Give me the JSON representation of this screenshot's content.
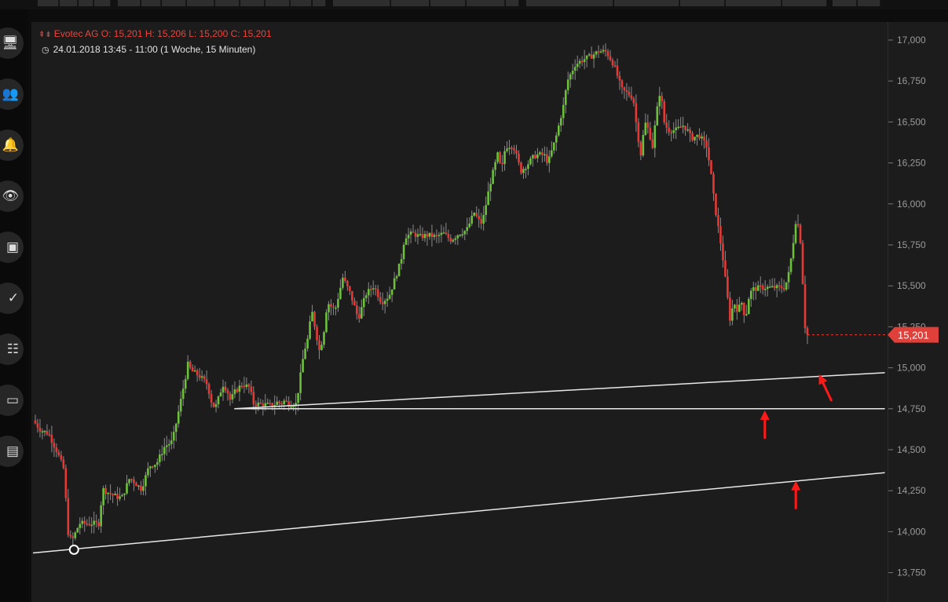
{
  "header": {
    "quote_line": "Evotec AG  O: 15,201  H: 15,206  L: 15,200  C: 15,201",
    "range_line": "24.01.2018 13:45 - 11:00   (1 Woche, 15 Minuten)"
  },
  "sidebar": [
    {
      "name": "monitor-icon",
      "glyph": "🖥"
    },
    {
      "name": "users-icon",
      "glyph": "👥"
    },
    {
      "name": "bell-icon",
      "glyph": "🔔"
    },
    {
      "name": "eye-icon",
      "glyph": "👁"
    },
    {
      "name": "card-icon",
      "glyph": "▣"
    },
    {
      "name": "check-icon",
      "glyph": "✓"
    },
    {
      "name": "list-icon",
      "glyph": "☷"
    },
    {
      "name": "window-icon",
      "glyph": "▭"
    },
    {
      "name": "id-card-icon",
      "glyph": "▤"
    }
  ],
  "colors": {
    "up": "#6cc13a",
    "down": "#e53935",
    "price_tag": "#e0403a",
    "background": "#1c1c1c",
    "arrow": "#ff1a1a"
  },
  "chart_data": {
    "type": "candlestick",
    "title": "Evotec AG",
    "ylim": [
      13750,
      17000
    ],
    "y_ticks": [
      "17,000",
      "16,750",
      "16,500",
      "16,250",
      "16,000",
      "15,750",
      "15,500",
      "15,250",
      "15,000",
      "14,750",
      "14,500",
      "14,250",
      "14,000",
      "13,750"
    ],
    "last_price_label": "15,201",
    "price_path": [
      [
        0,
        14680
      ],
      [
        0.01,
        14620
      ],
      [
        0.02,
        14600
      ],
      [
        0.03,
        14500
      ],
      [
        0.04,
        14380
      ],
      [
        0.045,
        14000
      ],
      [
        0.05,
        13940
      ],
      [
        0.06,
        14050
      ],
      [
        0.085,
        14050
      ],
      [
        0.09,
        14260
      ],
      [
        0.1,
        14230
      ],
      [
        0.11,
        14210
      ],
      [
        0.115,
        14210
      ],
      [
        0.125,
        14330
      ],
      [
        0.14,
        14260
      ],
      [
        0.15,
        14400
      ],
      [
        0.16,
        14420
      ],
      [
        0.17,
        14520
      ],
      [
        0.18,
        14550
      ],
      [
        0.19,
        14780
      ],
      [
        0.2,
        15020
      ],
      [
        0.205,
        14980
      ],
      [
        0.215,
        14950
      ],
      [
        0.225,
        14900
      ],
      [
        0.23,
        14800
      ],
      [
        0.235,
        14750
      ],
      [
        0.24,
        14820
      ],
      [
        0.245,
        14900
      ],
      [
        0.25,
        14870
      ],
      [
        0.255,
        14800
      ],
      [
        0.26,
        14850
      ],
      [
        0.27,
        14900
      ],
      [
        0.28,
        14880
      ],
      [
        0.28,
        14870
      ],
      [
        0.285,
        14780
      ],
      [
        0.29,
        14780
      ],
      [
        0.31,
        14770
      ],
      [
        0.315,
        14790
      ],
      [
        0.32,
        14780
      ],
      [
        0.325,
        14800
      ],
      [
        0.33,
        14780
      ],
      [
        0.34,
        14780
      ],
      [
        0.35,
        15100
      ],
      [
        0.355,
        15180
      ],
      [
        0.36,
        15350
      ],
      [
        0.37,
        15100
      ],
      [
        0.375,
        15200
      ],
      [
        0.38,
        15400
      ],
      [
        0.39,
        15350
      ],
      [
        0.4,
        15550
      ],
      [
        0.41,
        15450
      ],
      [
        0.42,
        15300
      ],
      [
        0.43,
        15450
      ],
      [
        0.44,
        15500
      ],
      [
        0.45,
        15400
      ],
      [
        0.46,
        15440
      ],
      [
        0.475,
        15650
      ],
      [
        0.48,
        15800
      ],
      [
        0.49,
        15820
      ],
      [
        0.5,
        15800
      ],
      [
        0.51,
        15810
      ],
      [
        0.52,
        15800
      ],
      [
        0.53,
        15820
      ],
      [
        0.54,
        15780
      ],
      [
        0.55,
        15820
      ],
      [
        0.56,
        15840
      ],
      [
        0.57,
        15950
      ],
      [
        0.575,
        15900
      ],
      [
        0.58,
        15880
      ],
      [
        0.585,
        16000
      ],
      [
        0.59,
        16120
      ],
      [
        0.6,
        16300
      ],
      [
        0.605,
        16200
      ],
      [
        0.61,
        16350
      ],
      [
        0.62,
        16360
      ],
      [
        0.625,
        16280
      ],
      [
        0.63,
        16200
      ],
      [
        0.64,
        16250
      ],
      [
        0.645,
        16280
      ],
      [
        0.65,
        16300
      ],
      [
        0.66,
        16300
      ],
      [
        0.665,
        16250
      ],
      [
        0.675,
        16400
      ],
      [
        0.68,
        16500
      ],
      [
        0.685,
        16600
      ],
      [
        0.69,
        16750
      ],
      [
        0.7,
        16850
      ],
      [
        0.71,
        16880
      ],
      [
        0.72,
        16900
      ],
      [
        0.73,
        16930
      ],
      [
        0.74,
        16930
      ],
      [
        0.75,
        16850
      ],
      [
        0.76,
        16700
      ],
      [
        0.775,
        16650
      ],
      [
        0.78,
        16450
      ],
      [
        0.785,
        16300
      ],
      [
        0.79,
        16500
      ],
      [
        0.795,
        16450
      ],
      [
        0.8,
        16350
      ],
      [
        0.805,
        16550
      ],
      [
        0.81,
        16700
      ],
      [
        0.815,
        16500
      ],
      [
        0.82,
        16450
      ],
      [
        0.83,
        16450
      ],
      [
        0.84,
        16480
      ],
      [
        0.845,
        16450
      ],
      [
        0.85,
        16400
      ],
      [
        0.86,
        16420
      ],
      [
        0.87,
        16350
      ],
      [
        0.875,
        16200
      ],
      [
        0.88,
        16000
      ],
      [
        0.885,
        15850
      ],
      [
        0.89,
        15700
      ],
      [
        0.895,
        15500
      ],
      [
        0.9,
        15300
      ],
      [
        0.905,
        15400
      ],
      [
        0.91,
        15350
      ],
      [
        0.915,
        15400
      ],
      [
        0.92,
        15300
      ],
      [
        0.925,
        15450
      ],
      [
        0.93,
        15480
      ],
      [
        0.94,
        15490
      ],
      [
        0.96,
        15490
      ],
      [
        0.97,
        15490
      ],
      [
        0.975,
        15550
      ],
      [
        0.98,
        15700
      ],
      [
        0.985,
        15900
      ],
      [
        0.99,
        15850
      ],
      [
        0.993,
        15600
      ],
      [
        0.996,
        15350
      ],
      [
        0.998,
        15150
      ],
      [
        1,
        15201
      ]
    ],
    "trendlines": [
      {
        "name": "upper-trendline",
        "from": [
          0.26,
          14750
        ],
        "to": [
          1.1,
          14970
        ]
      },
      {
        "name": "horizontal-support",
        "from": [
          0.26,
          14750
        ],
        "to": [
          1.1,
          14750
        ]
      },
      {
        "name": "lower-trendline",
        "from": [
          0,
          13870
        ],
        "to": [
          1.1,
          14360
        ]
      }
    ],
    "pivot_point": [
      0.053,
      13890
    ],
    "arrows": [
      {
        "name": "arrow-upper-trendline",
        "at": [
          1.015,
          14960
        ],
        "dir": "up-left"
      },
      {
        "name": "arrow-horizontal-support",
        "at": [
          0.945,
          14740
        ],
        "dir": "up"
      },
      {
        "name": "arrow-lower-trendline",
        "at": [
          0.985,
          14310
        ],
        "dir": "up"
      }
    ]
  }
}
